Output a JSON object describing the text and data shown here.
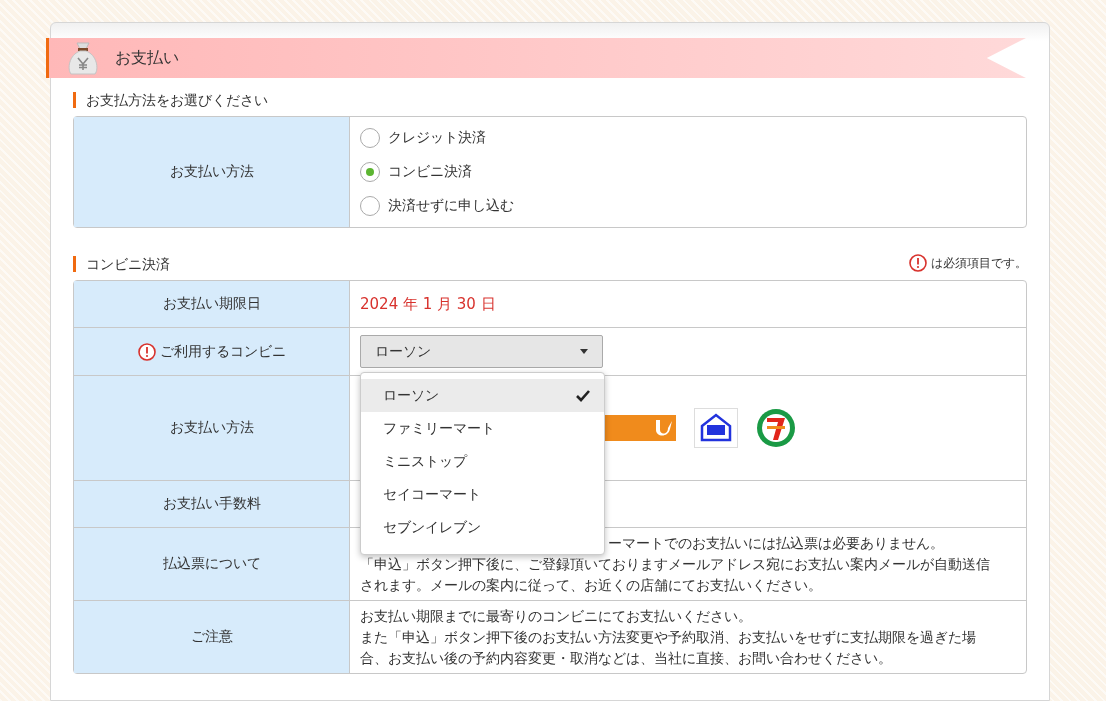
{
  "banner": {
    "title": "お支払い"
  },
  "method_section": {
    "heading": "お支払方法をお選びください",
    "label": "お支払い方法",
    "options": [
      {
        "label": "クレジット決済",
        "selected": false
      },
      {
        "label": "コンビニ決済",
        "selected": true
      },
      {
        "label": "決済せずに申し込む",
        "selected": false
      }
    ]
  },
  "konbini_section": {
    "heading": "コンビニ決済",
    "required_note": "は必須項目です。",
    "rows": [
      {
        "kind": "deadline",
        "label": "お支払い期限日",
        "value": "2024 年 1 月 30 日"
      },
      {
        "kind": "select",
        "label": "ご利用するコンビニ",
        "required": true,
        "value": "ローソン"
      },
      {
        "kind": "logos",
        "label": "お支払い方法"
      },
      {
        "kind": "blank",
        "label": "お支払い手数料"
      },
      {
        "kind": "notes",
        "label": "払込票について",
        "covered_text": "ーマートでのお支払いには払込票は必要ありません。",
        "lines": [
          "「申込」ボタン押下後に、ご登録頂いておりますメールアドレス宛にお支払い案内メールが自動送信",
          "されます。メールの案内に従って、お近くの店舗にてお支払いください。"
        ]
      },
      {
        "kind": "notes",
        "label": "ご注意",
        "lines": [
          "お支払い期限までに最寄りのコンビニにてお支払いください。",
          "また「申込」ボタン押下後のお支払い方法変更や予約取消、お支払いをせずに支払期限を過ぎた場",
          "合、お支払い後の予約内容変更・取消などは、当社に直接、お問い合わせください。"
        ]
      }
    ]
  },
  "dropdown": {
    "options": [
      {
        "label": "ローソン",
        "selected": true
      },
      {
        "label": "ファミリーマート",
        "selected": false
      },
      {
        "label": "ミニストップ",
        "selected": false
      },
      {
        "label": "セイコーマート",
        "selected": false
      },
      {
        "label": "セブンイレブン",
        "selected": false
      }
    ]
  }
}
